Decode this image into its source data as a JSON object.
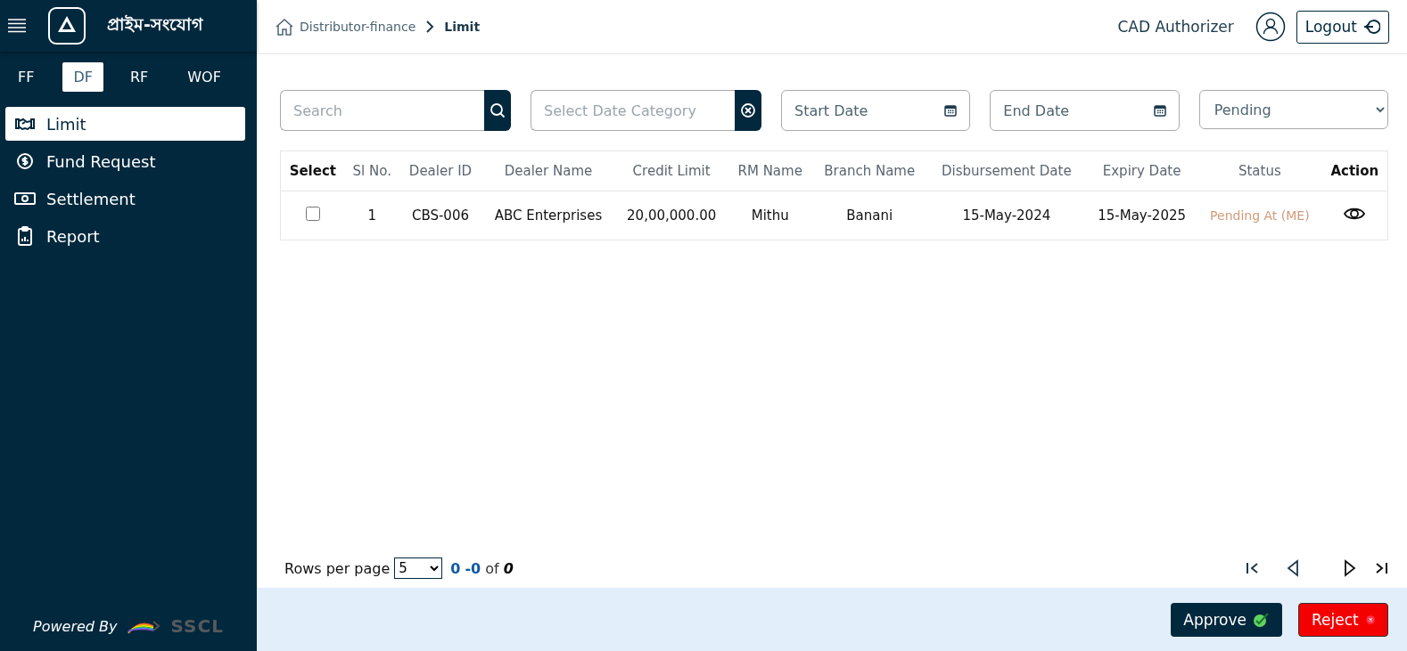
{
  "brand": {
    "name": "প্রাইম-সংযোগ"
  },
  "module_tabs": [
    {
      "label": "FF",
      "selected": false
    },
    {
      "label": "DF",
      "selected": true
    },
    {
      "label": "RF",
      "selected": false
    },
    {
      "label": "WOF",
      "selected": false
    }
  ],
  "sidebar": {
    "items": [
      {
        "label": "Limit",
        "kind": "handshake",
        "selected": true
      },
      {
        "label": "Fund Request",
        "kind": "dollar",
        "selected": false
      },
      {
        "label": "Settlement",
        "kind": "cash",
        "selected": false
      },
      {
        "label": "Report",
        "kind": "clipboard",
        "selected": false
      }
    ],
    "footer": {
      "label": "Powered By",
      "logo_text": "SSCL"
    }
  },
  "breadcrumb": [
    {
      "label": "Distributor-finance",
      "current": false
    },
    {
      "label": "Limit",
      "current": true
    }
  ],
  "user": {
    "role": "CAD Authorizer",
    "logout": "Logout"
  },
  "filters": {
    "search": {
      "placeholder": "Search"
    },
    "date_category": {
      "placeholder": "Select Date Category"
    },
    "start_date": {
      "placeholder": "Start Date"
    },
    "end_date": {
      "placeholder": "End Date"
    },
    "status": {
      "value": "Pending"
    }
  },
  "table": {
    "columns": [
      {
        "label": "Select",
        "kind": "control"
      },
      {
        "label": "Sl No.",
        "kind": "data"
      },
      {
        "label": "Dealer ID",
        "kind": "data"
      },
      {
        "label": "Dealer Name",
        "kind": "data"
      },
      {
        "label": "Credit Limit",
        "kind": "data"
      },
      {
        "label": "RM Name",
        "kind": "data"
      },
      {
        "label": "Branch Name",
        "kind": "data"
      },
      {
        "label": "Disbursement Date",
        "kind": "data"
      },
      {
        "label": "Expiry Date",
        "kind": "data"
      },
      {
        "label": "Status",
        "kind": "data"
      },
      {
        "label": "Action",
        "kind": "control"
      }
    ],
    "rows": [
      {
        "checked": false,
        "sl": "1",
        "dealer_id": "CBS-006",
        "dealer_name": "ABC Enterprises",
        "credit_limit": "20,00,000.00",
        "rm_name": "Mithu",
        "branch": "Banani",
        "disbursement_date": "15-May-2024",
        "expiry_date": "15-May-2025",
        "status": "Pending At (ME)"
      }
    ]
  },
  "pagination": {
    "rows_per_page_label": "Rows per page",
    "rows_per_page": "5",
    "range_start": "0",
    "range_end": "-0",
    "of": "of",
    "total": "0"
  },
  "actions": {
    "approve": "Approve",
    "reject": "Reject"
  }
}
